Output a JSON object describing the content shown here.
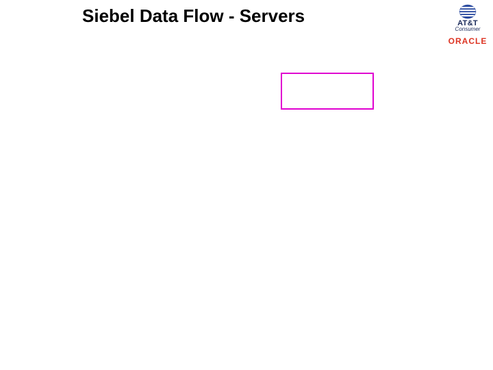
{
  "title": "Siebel Data Flow - Servers",
  "logos": {
    "att": {
      "name": "AT&T",
      "sub": "Consumer"
    },
    "oracle": {
      "name": "ORACLE"
    }
  },
  "shapes": {
    "magenta_box_label": ""
  }
}
